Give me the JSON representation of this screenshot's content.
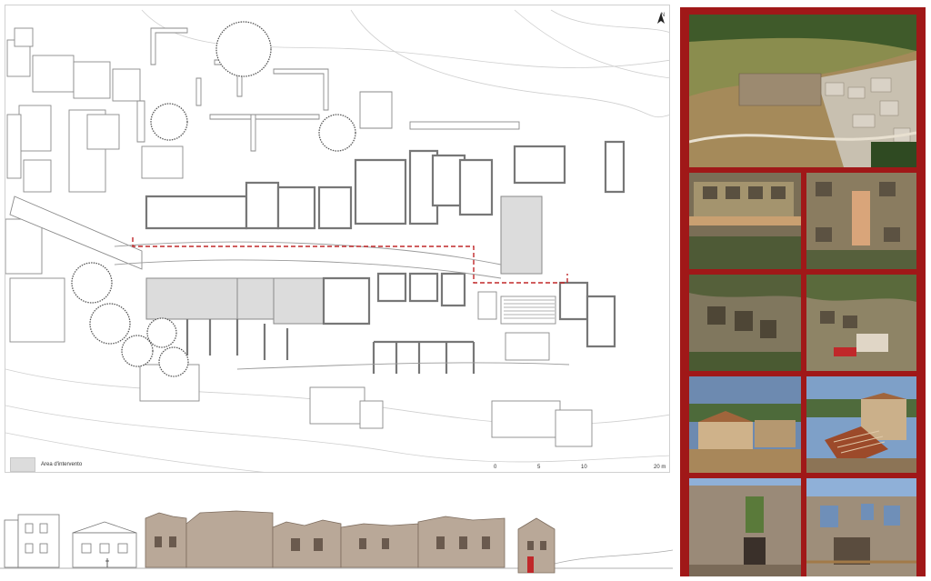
{
  "plan": {
    "legend_label": "Area d'intervento",
    "scale": {
      "ticks": [
        "0",
        "5",
        "10",
        "20 m"
      ]
    },
    "north_label": "N"
  },
  "photos": [
    {
      "name": "aerial-overview-photo",
      "desc": "aerial"
    },
    {
      "name": "aerial-detail-photo-1",
      "desc": "aerial"
    },
    {
      "name": "aerial-detail-photo-2",
      "desc": "aerial"
    },
    {
      "name": "aerial-detail-photo-3",
      "desc": "aerial"
    },
    {
      "name": "aerial-detail-photo-4",
      "desc": "aerial"
    },
    {
      "name": "building-exterior-photo-1",
      "desc": "building"
    },
    {
      "name": "building-exterior-photo-2",
      "desc": "building"
    },
    {
      "name": "ruin-wall-photo-1",
      "desc": "ruin"
    },
    {
      "name": "ruin-wall-photo-2",
      "desc": "ruin"
    }
  ],
  "colors": {
    "frame": "#a01818",
    "accent": "#c0282a",
    "shaded": "#dcdcdc"
  }
}
